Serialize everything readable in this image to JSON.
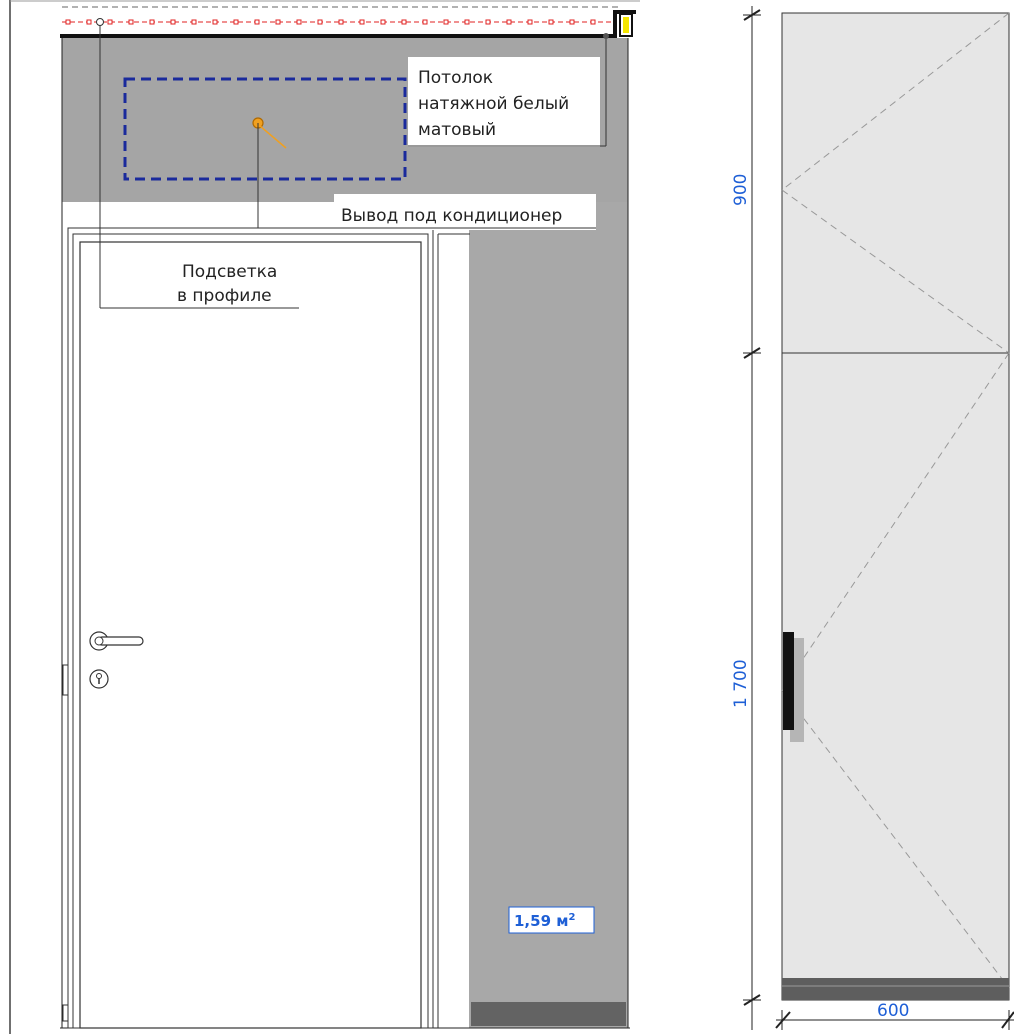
{
  "labels": {
    "ceiling_line1": "Потолок",
    "ceiling_line2": "натяжной белый",
    "ceiling_line3": "матовый",
    "ac_outlet": "Вывод под кондиционер",
    "lighting_line1": "Подсветка",
    "lighting_line2": "в профиле"
  },
  "area": {
    "value": "1,59 м",
    "superscript": "2"
  },
  "dimensions": {
    "upper_height": "900",
    "lower_height": "1 700",
    "width": "600"
  },
  "colors": {
    "wall_gray": "#a8a8a8",
    "ceiling_gray": "#a5a5a5",
    "door_white": "#ffffff",
    "cabinet_panel": "#e6e6e6",
    "dimension_blue": "#1e5fd6",
    "ac_zone_blue": "#1a2a9c",
    "led_red": "#e02020",
    "ac_orange": "#f0a020",
    "fixture_yellow": "#f5e600"
  }
}
